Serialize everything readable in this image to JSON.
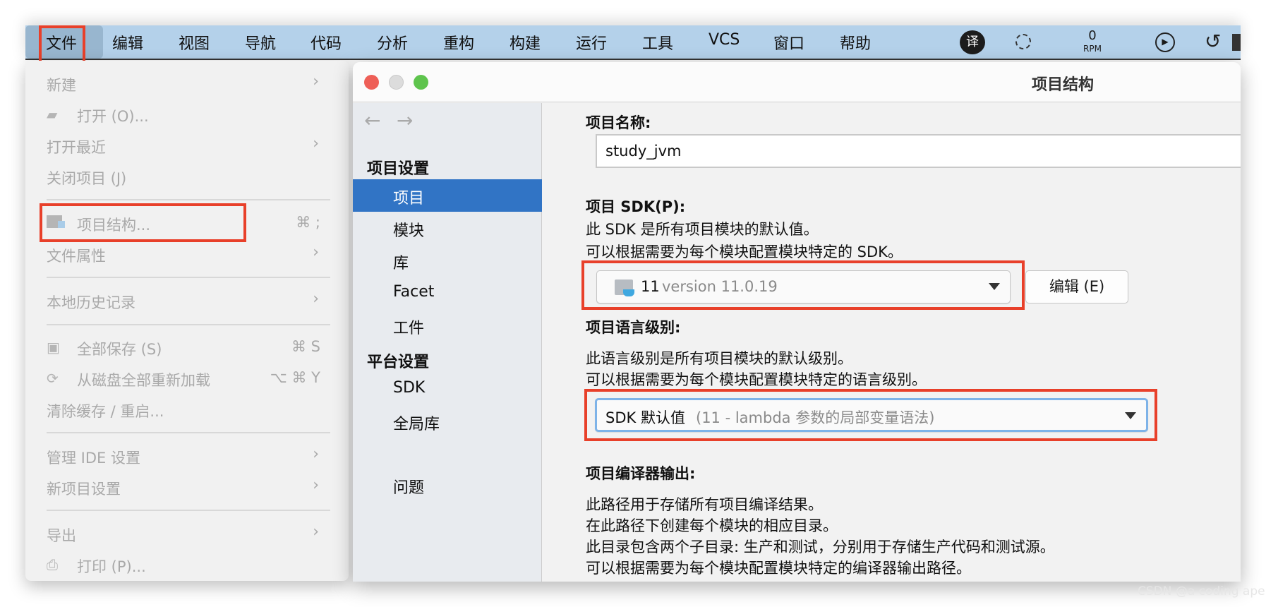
{
  "menubar": {
    "items": [
      "文件",
      "编辑",
      "视图",
      "导航",
      "代码",
      "分析",
      "重构",
      "构建",
      "运行",
      "工具",
      "VCS",
      "窗口",
      "帮助"
    ],
    "tray": {
      "translate_icon": "译",
      "rpm_value": "0",
      "rpm_label": "RPM"
    }
  },
  "file_menu": {
    "items": [
      {
        "label": "新建",
        "submenu": true
      },
      {
        "label": "打开 (O)...",
        "icon": "folder-open-icon"
      },
      {
        "label": "打开最近",
        "submenu": true
      },
      {
        "label": "关闭项目 (J)"
      },
      {
        "label": "项目结构...",
        "icon": "project-structure-icon",
        "shortcut": "⌘ ;"
      },
      {
        "label": "文件属性",
        "submenu": true
      },
      {
        "label": "本地历史记录",
        "submenu": true
      },
      {
        "label": "全部保存 (S)",
        "icon": "save-icon",
        "shortcut": "⌘ S"
      },
      {
        "label": "从磁盘全部重新加载",
        "icon": "reload-icon",
        "shortcut": "⌥ ⌘ Y"
      },
      {
        "label": "清除缓存 / 重启..."
      },
      {
        "label": "管理 IDE 设置",
        "submenu": true
      },
      {
        "label": "新项目设置",
        "submenu": true
      },
      {
        "label": "导出",
        "submenu": true
      },
      {
        "label": "打印 (P)...",
        "icon": "print-icon"
      }
    ]
  },
  "dialog": {
    "title": "项目结构",
    "sidebar": {
      "section_project": "项目设置",
      "items_project": [
        "项目",
        "模块",
        "库",
        "Facet",
        "工件"
      ],
      "section_platform": "平台设置",
      "items_platform": [
        "SDK",
        "全局库"
      ],
      "problems": "问题",
      "selected": "项目"
    },
    "project_name": {
      "label": "项目名称:",
      "value": "study_jvm"
    },
    "sdk": {
      "label": "项目 SDK(P):",
      "desc1": "此 SDK 是所有项目模块的默认值。",
      "desc2": "可以根据需要为每个模块配置模块特定的 SDK。",
      "value_main": "11",
      "value_detail": "version 11.0.19",
      "edit_button": "编辑 (E)"
    },
    "language_level": {
      "label": "项目语言级别:",
      "desc1": "此语言级别是所有项目模块的默认级别。",
      "desc2": "可以根据需要为每个模块配置模块特定的语言级别。",
      "value_main": "SDK 默认值",
      "value_detail": "(11 - lambda 参数的局部变量语法)"
    },
    "compiler_output": {
      "label": "项目编译器输出:",
      "lines": [
        "此路径用于存储所有项目编译结果。",
        "在此路径下创建每个模块的相应目录。",
        "此目录包含两个子目录: 生产和测试，分别用于存储生产代码和测试源。",
        "可以根据需要为每个模块配置模块特定的编译器输出路径。"
      ]
    }
  },
  "watermark": "CSDN @a coding ape",
  "colors": {
    "highlight_box": "#e8402a",
    "selection": "#3174c5",
    "menubar": "#b4d1ea"
  }
}
